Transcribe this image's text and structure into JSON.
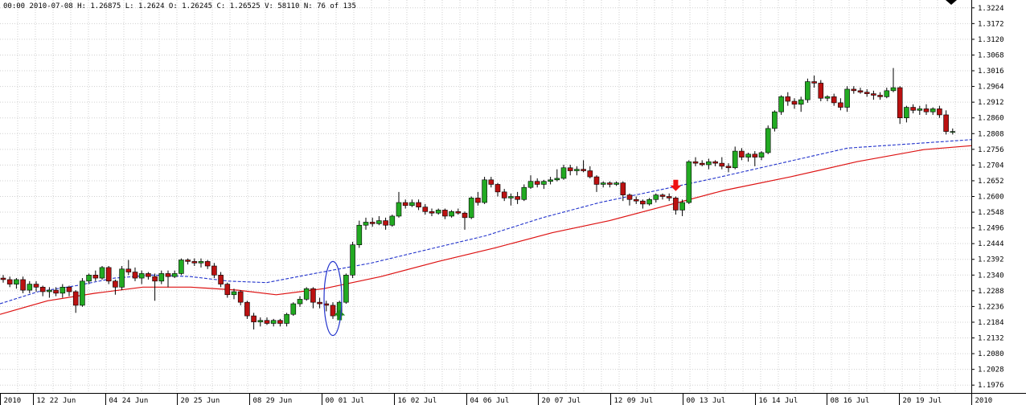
{
  "info": {
    "text": "00:00 2010-07-08 H: 1.26875 L: 1.2624 O: 1.26245 C: 1.26525 V: 58110 N: 76 of 135"
  },
  "colors": {
    "up": "#22aa22",
    "down": "#bb1111",
    "wick": "#000000",
    "ma_fast": "#2233cc",
    "ma_slow": "#dd1111",
    "grid": "#d0d0d0",
    "buy_arrow": "#1a8c1a",
    "sell_arrow": "#ee1111",
    "ellipse": "#2233cc"
  },
  "chart_data": {
    "type": "candlestick",
    "ylim": [
      1.195,
      1.325
    ],
    "y_ticks": [
      "1.3224",
      "1.3172",
      "1.3120",
      "1.3068",
      "1.3016",
      "1.2964",
      "1.2912",
      "1.2860",
      "1.2808",
      "1.2756",
      "1.2704",
      "1.2652",
      "1.2600",
      "1.2548",
      "1.2496",
      "1.2444",
      "1.2392",
      "1.2340",
      "1.2288",
      "1.2236",
      "1.2184",
      "1.2132",
      "1.2080",
      "1.2028",
      "1.1976"
    ],
    "x_ticks": [
      {
        "label": "2010",
        "index": 0
      },
      {
        "label": "12 22 Jun",
        "index": 5
      },
      {
        "label": "04 24 Jun",
        "index": 16
      },
      {
        "label": "20 25 Jun",
        "index": 27
      },
      {
        "label": "08 29 Jun",
        "index": 38
      },
      {
        "label": "00 01 Jul",
        "index": 49
      },
      {
        "label": "16 02 Jul",
        "index": 60
      },
      {
        "label": "04 06 Jul",
        "index": 71
      },
      {
        "label": "20 07 Jul",
        "index": 82
      },
      {
        "label": "12 09 Jul",
        "index": 93
      },
      {
        "label": "00 13 Jul",
        "index": 104
      },
      {
        "label": "16 14 Jul",
        "index": 115
      },
      {
        "label": "08 16 Jul",
        "index": 126
      },
      {
        "label": "20 19 Jul",
        "index": 137
      },
      {
        "label": "2010",
        "index": 148
      }
    ],
    "ohlc": [
      [
        1.233,
        1.234,
        1.2315,
        1.2325
      ],
      [
        1.2325,
        1.2335,
        1.23,
        1.231
      ],
      [
        1.231,
        1.233,
        1.2295,
        1.2325
      ],
      [
        1.2325,
        1.2335,
        1.228,
        1.229
      ],
      [
        1.229,
        1.232,
        1.228,
        1.231
      ],
      [
        1.231,
        1.232,
        1.2285,
        1.23
      ],
      [
        1.23,
        1.2305,
        1.227,
        1.2285
      ],
      [
        1.2285,
        1.23,
        1.2265,
        1.229
      ],
      [
        1.229,
        1.23,
        1.227,
        1.228
      ],
      [
        1.228,
        1.231,
        1.2265,
        1.23
      ],
      [
        1.23,
        1.2305,
        1.227,
        1.2285
      ],
      [
        1.2285,
        1.229,
        1.2215,
        1.224
      ],
      [
        1.224,
        1.233,
        1.2235,
        1.232
      ],
      [
        1.232,
        1.2345,
        1.231,
        1.234
      ],
      [
        1.234,
        1.2355,
        1.232,
        1.233
      ],
      [
        1.233,
        1.237,
        1.2325,
        1.2365
      ],
      [
        1.2365,
        1.237,
        1.231,
        1.232
      ],
      [
        1.232,
        1.2325,
        1.2275,
        1.23
      ],
      [
        1.23,
        1.237,
        1.229,
        1.236
      ],
      [
        1.236,
        1.239,
        1.234,
        1.235
      ],
      [
        1.235,
        1.2365,
        1.232,
        1.233
      ],
      [
        1.233,
        1.2355,
        1.231,
        1.2345
      ],
      [
        1.2345,
        1.235,
        1.2325,
        1.2335
      ],
      [
        1.2335,
        1.2345,
        1.2255,
        1.232
      ],
      [
        1.232,
        1.2355,
        1.231,
        1.2345
      ],
      [
        1.2345,
        1.2355,
        1.23,
        1.2335
      ],
      [
        1.2335,
        1.2355,
        1.233,
        1.2345
      ],
      [
        1.2345,
        1.2395,
        1.234,
        1.239
      ],
      [
        1.239,
        1.2395,
        1.2375,
        1.2385
      ],
      [
        1.2385,
        1.2395,
        1.237,
        1.238
      ],
      [
        1.238,
        1.2395,
        1.2365,
        1.2385
      ],
      [
        1.2385,
        1.239,
        1.236,
        1.237
      ],
      [
        1.237,
        1.238,
        1.233,
        1.234
      ],
      [
        1.234,
        1.235,
        1.23,
        1.231
      ],
      [
        1.231,
        1.2315,
        1.2265,
        1.2275
      ],
      [
        1.2275,
        1.2295,
        1.226,
        1.2285
      ],
      [
        1.2285,
        1.229,
        1.224,
        1.225
      ],
      [
        1.225,
        1.2255,
        1.2195,
        1.2205
      ],
      [
        1.2205,
        1.2215,
        1.216,
        1.2185
      ],
      [
        1.2185,
        1.22,
        1.217,
        1.219
      ],
      [
        1.219,
        1.22,
        1.2175,
        1.218
      ],
      [
        1.218,
        1.2195,
        1.217,
        1.219
      ],
      [
        1.219,
        1.2195,
        1.217,
        1.218
      ],
      [
        1.218,
        1.2215,
        1.217,
        1.221
      ],
      [
        1.221,
        1.225,
        1.2205,
        1.2245
      ],
      [
        1.2245,
        1.227,
        1.2235,
        1.226
      ],
      [
        1.226,
        1.23,
        1.2255,
        1.2295
      ],
      [
        1.2295,
        1.23,
        1.223,
        1.225
      ],
      [
        1.225,
        1.2265,
        1.223,
        1.2245
      ],
      [
        1.2245,
        1.2255,
        1.222,
        1.224
      ],
      [
        1.224,
        1.225,
        1.2195,
        1.2205
      ],
      [
        1.2205,
        1.2255,
        1.22,
        1.225
      ],
      [
        1.225,
        1.2345,
        1.2245,
        1.234
      ],
      [
        1.234,
        1.245,
        1.233,
        1.244
      ],
      [
        1.244,
        1.252,
        1.243,
        1.2505
      ],
      [
        1.2505,
        1.253,
        1.249,
        1.2515
      ],
      [
        1.2515,
        1.253,
        1.25,
        1.251
      ],
      [
        1.251,
        1.2535,
        1.2505,
        1.252
      ],
      [
        1.252,
        1.253,
        1.249,
        1.2505
      ],
      [
        1.2505,
        1.254,
        1.25,
        1.2535
      ],
      [
        1.2535,
        1.2615,
        1.253,
        1.258
      ],
      [
        1.258,
        1.259,
        1.256,
        1.257
      ],
      [
        1.257,
        1.259,
        1.2565,
        1.258
      ],
      [
        1.258,
        1.259,
        1.2555,
        1.2565
      ],
      [
        1.2565,
        1.2575,
        1.254,
        1.255
      ],
      [
        1.255,
        1.256,
        1.2535,
        1.2545
      ],
      [
        1.2545,
        1.256,
        1.254,
        1.2555
      ],
      [
        1.2555,
        1.256,
        1.2525,
        1.2535
      ],
      [
        1.2535,
        1.2555,
        1.253,
        1.255
      ],
      [
        1.255,
        1.256,
        1.254,
        1.2545
      ],
      [
        1.2545,
        1.255,
        1.249,
        1.253
      ],
      [
        1.253,
        1.26,
        1.2525,
        1.2595
      ],
      [
        1.2595,
        1.2615,
        1.257,
        1.258
      ],
      [
        1.258,
        1.2665,
        1.2575,
        1.2655
      ],
      [
        1.2655,
        1.2665,
        1.263,
        1.264
      ],
      [
        1.264,
        1.2645,
        1.26,
        1.2615
      ],
      [
        1.2615,
        1.2625,
        1.2585,
        1.2595
      ],
      [
        1.2595,
        1.261,
        1.257,
        1.26
      ],
      [
        1.26,
        1.2615,
        1.2575,
        1.259
      ],
      [
        1.259,
        1.264,
        1.2585,
        1.263
      ],
      [
        1.263,
        1.267,
        1.2625,
        1.265
      ],
      [
        1.265,
        1.266,
        1.263,
        1.264
      ],
      [
        1.264,
        1.2655,
        1.2625,
        1.265
      ],
      [
        1.265,
        1.2665,
        1.264,
        1.2655
      ],
      [
        1.2655,
        1.269,
        1.265,
        1.266
      ],
      [
        1.266,
        1.2705,
        1.2655,
        1.2695
      ],
      [
        1.2695,
        1.2705,
        1.267,
        1.2685
      ],
      [
        1.2685,
        1.27,
        1.267,
        1.269
      ],
      [
        1.269,
        1.272,
        1.268,
        1.2685
      ],
      [
        1.2685,
        1.27,
        1.266,
        1.2665
      ],
      [
        1.2665,
        1.267,
        1.2615,
        1.264
      ],
      [
        1.264,
        1.265,
        1.263,
        1.2645
      ],
      [
        1.2645,
        1.265,
        1.263,
        1.264
      ],
      [
        1.264,
        1.265,
        1.2635,
        1.2645
      ],
      [
        1.2645,
        1.265,
        1.2585,
        1.2605
      ],
      [
        1.2605,
        1.261,
        1.257,
        1.259
      ],
      [
        1.259,
        1.26,
        1.2575,
        1.2585
      ],
      [
        1.2585,
        1.259,
        1.256,
        1.2575
      ],
      [
        1.2575,
        1.2595,
        1.257,
        1.259
      ],
      [
        1.259,
        1.261,
        1.258,
        1.2605
      ],
      [
        1.2605,
        1.261,
        1.259,
        1.26
      ],
      [
        1.26,
        1.261,
        1.2585,
        1.2595
      ],
      [
        1.2595,
        1.26,
        1.254,
        1.2555
      ],
      [
        1.2555,
        1.259,
        1.2535,
        1.258
      ],
      [
        1.258,
        1.272,
        1.2575,
        1.2715
      ],
      [
        1.2715,
        1.273,
        1.27,
        1.271
      ],
      [
        1.271,
        1.272,
        1.27,
        1.2705
      ],
      [
        1.2705,
        1.2725,
        1.269,
        1.2715
      ],
      [
        1.2715,
        1.272,
        1.27,
        1.271
      ],
      [
        1.271,
        1.273,
        1.269,
        1.27
      ],
      [
        1.27,
        1.271,
        1.268,
        1.2695
      ],
      [
        1.2695,
        1.2765,
        1.269,
        1.275
      ],
      [
        1.275,
        1.276,
        1.272,
        1.273
      ],
      [
        1.273,
        1.2745,
        1.2715,
        1.274
      ],
      [
        1.274,
        1.275,
        1.27,
        1.273
      ],
      [
        1.273,
        1.275,
        1.272,
        1.2745
      ],
      [
        1.2745,
        1.2835,
        1.274,
        1.2825
      ],
      [
        1.2825,
        1.2885,
        1.2815,
        1.288
      ],
      [
        1.288,
        1.2935,
        1.287,
        1.293
      ],
      [
        1.293,
        1.2945,
        1.29,
        1.2915
      ],
      [
        1.2915,
        1.2925,
        1.289,
        1.2905
      ],
      [
        1.2905,
        1.293,
        1.288,
        1.292
      ],
      [
        1.292,
        1.299,
        1.291,
        1.298
      ],
      [
        1.298,
        1.3,
        1.296,
        1.2975
      ],
      [
        1.2975,
        1.2985,
        1.2915,
        1.2925
      ],
      [
        1.2925,
        1.2935,
        1.2915,
        1.293
      ],
      [
        1.293,
        1.294,
        1.29,
        1.291
      ],
      [
        1.291,
        1.2925,
        1.2885,
        1.2895
      ],
      [
        1.2895,
        1.2965,
        1.288,
        1.2955
      ],
      [
        1.2955,
        1.2965,
        1.294,
        1.295
      ],
      [
        1.295,
        1.296,
        1.294,
        1.2945
      ],
      [
        1.2945,
        1.2955,
        1.293,
        1.294
      ],
      [
        1.294,
        1.295,
        1.292,
        1.2935
      ],
      [
        1.2935,
        1.2945,
        1.292,
        1.293
      ],
      [
        1.293,
        1.296,
        1.2925,
        1.295
      ],
      [
        1.295,
        1.3025,
        1.2945,
        1.296
      ],
      [
        1.296,
        1.2965,
        1.284,
        1.286
      ],
      [
        1.286,
        1.29,
        1.2845,
        1.2895
      ],
      [
        1.2895,
        1.2905,
        1.2875,
        1.2885
      ],
      [
        1.2885,
        1.29,
        1.287,
        1.289
      ],
      [
        1.289,
        1.2905,
        1.287,
        1.288
      ],
      [
        1.288,
        1.2895,
        1.287,
        1.289
      ],
      [
        1.289,
        1.29,
        1.286,
        1.287
      ],
      [
        1.287,
        1.2885,
        1.2805,
        1.2815
      ],
      [
        1.2815,
        1.2825,
        1.2805,
        1.2815
      ]
    ],
    "ma_fast": [
      [
        0,
        1.2245
      ],
      [
        8,
        1.2285
      ],
      [
        16,
        1.2305
      ],
      [
        24,
        1.233
      ],
      [
        32,
        1.234
      ],
      [
        40,
        1.2335
      ],
      [
        48,
        1.232
      ],
      [
        56,
        1.2315
      ],
      [
        66,
        1.2345
      ],
      [
        78,
        1.238
      ],
      [
        90,
        1.2425
      ],
      [
        102,
        1.247
      ],
      [
        114,
        1.253
      ],
      [
        126,
        1.258
      ],
      [
        138,
        1.262
      ],
      [
        150,
        1.266
      ],
      [
        164,
        1.271
      ],
      [
        178,
        1.276
      ],
      [
        192,
        1.2775
      ],
      [
        204,
        1.2788
      ]
    ],
    "ma_slow": [
      [
        0,
        1.221
      ],
      [
        10,
        1.2255
      ],
      [
        20,
        1.228
      ],
      [
        30,
        1.23
      ],
      [
        40,
        1.23
      ],
      [
        50,
        1.229
      ],
      [
        58,
        1.2275
      ],
      [
        68,
        1.2295
      ],
      [
        80,
        1.2335
      ],
      [
        92,
        1.2385
      ],
      [
        104,
        1.243
      ],
      [
        116,
        1.248
      ],
      [
        128,
        1.252
      ],
      [
        140,
        1.257
      ],
      [
        152,
        1.262
      ],
      [
        166,
        1.2665
      ],
      [
        180,
        1.2715
      ],
      [
        194,
        1.2755
      ],
      [
        204,
        1.2768
      ]
    ],
    "markers": [
      {
        "type": "buy-arrow",
        "index": 51,
        "price": 1.2225
      },
      {
        "type": "sell-arrow",
        "index": 102,
        "price": 1.2655
      },
      {
        "type": "ellipse",
        "index": 50,
        "price_top": 1.2385,
        "price_bottom": 1.214
      }
    ]
  }
}
